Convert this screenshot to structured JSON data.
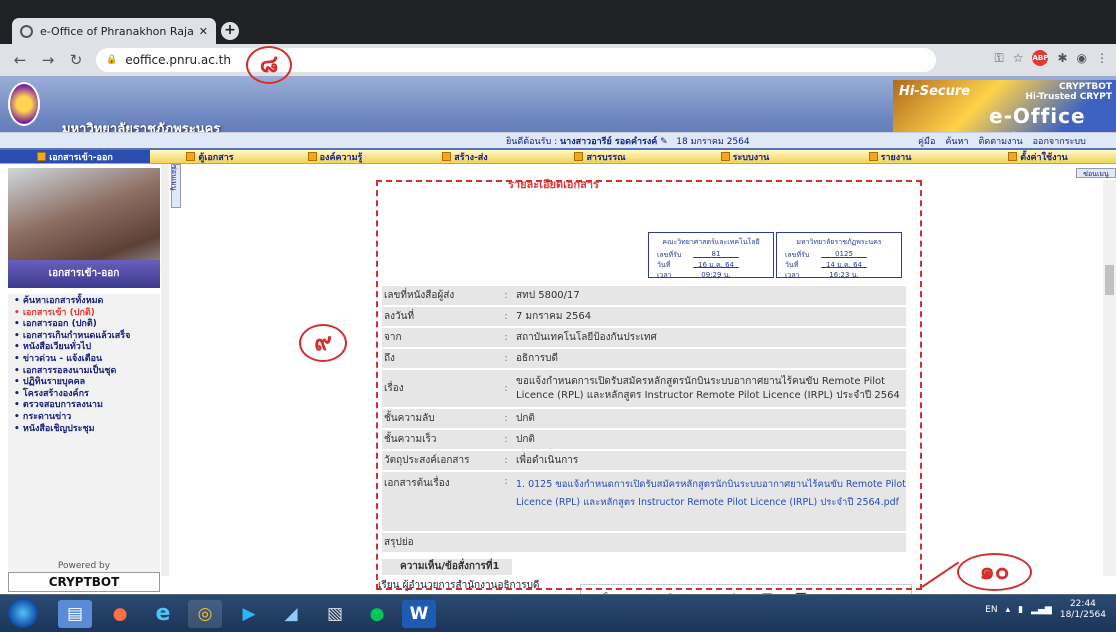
{
  "browser": {
    "tab_title": "e-Office of Phranakhon Rajabhat",
    "url": "eoffice.pnru.ac.th"
  },
  "header": {
    "university": "มหาวิทยาลัยราชภัฏพระนคร",
    "cryptbot": "CRYPTBOT",
    "hitrusted": "Hi-Trusted CRYPT",
    "hisecure": "Hi-Secure",
    "eoffice": "e-Office",
    "bot": "BOT",
    "welcome_prefix": "ยินดีต้อนรับ :",
    "welcome_user": "นางสาวอารีย์ รอดคำรงค์",
    "date": "18 มกราคม 2564",
    "tools": [
      "คู่มือ",
      "ค้นหา",
      "ติดตามงาน",
      "ออกจากระบบ"
    ]
  },
  "menu": [
    "เอกสารเข้า-ออก",
    "ตู้เอกสาร",
    "องค์ความรู้",
    "สร้าง-ส่ง",
    "สารบรรณ",
    "ระบบงาน",
    "รายงาน",
    "ตั้งค่าใช้งาน"
  ],
  "sidebar": {
    "section_label": "เอกสารเข้า-ออก",
    "items": [
      "ค้นหาเอกสารทั้งหมด",
      "เอกสารเข้า (ปกติ)",
      "เอกสารออก (ปกติ)",
      "เอกสารเกินกำหนดแล้วเสร็จ",
      "หนังสือเวียนทั่วไป",
      "ข่าวด่วน - แจ้งเตือน",
      "เอกสารรอลงนามเป็นชุด",
      "ปฏิทินรายบุคคล",
      "โครงสร้างองค์กร",
      "ตรวจสอบการลงนาม",
      "กระดานข่าว",
      "หนังสือเชิญประชุม"
    ],
    "powered": "Powered by",
    "cryptbot": "CRYPTBOT",
    "tab_label": "ซ่อนเมนู"
  },
  "content_tab": "ซ่อนเมนู",
  "document": {
    "title": "รายละเอียดเอกสาร",
    "stamp1": {
      "org": "คณะวิทยาศาสตร์และเทคโนโลยี",
      "no_label": "เลขที่รับ",
      "no": "81",
      "date_label": "วันที่",
      "date": "16 ม.ค. 64",
      "time_label": "เวลา",
      "time": "09:29 น."
    },
    "stamp2": {
      "org": "มหาวิทยาลัยราชภัฏพระนคร",
      "no_label": "เลขที่รับ",
      "no": "0125",
      "date_label": "วันที่",
      "date": "14 ม.ค. 64",
      "time_label": "เวลา",
      "time": "16:23 น."
    },
    "rows": [
      {
        "label": "เลขที่หนังสือผู้ส่ง",
        "value": "สทป 5800/17"
      },
      {
        "label": "ลงวันที่",
        "value": "7 มกราคม 2564"
      },
      {
        "label": "จาก",
        "value": "สถาบันเทคโนโลยีป้องกันประเทศ"
      },
      {
        "label": "ถึง",
        "value": "อธิการบดี"
      },
      {
        "label": "เรื่อง",
        "value": "ขอแจ้งกำหนดการเปิดรับสมัครหลักสูตรนักบินระบบอากาศยานไร้คนขับ Remote Pilot Licence (RPL) และหลักสูตร Instructor Remote Pilot Licence (IRPL) ประจำปี 2564"
      },
      {
        "label": "ชั้นความลับ",
        "value": "ปกติ"
      },
      {
        "label": "ชั้นความเร็ว",
        "value": "ปกติ"
      },
      {
        "label": "วัตถุประสงค์เอกสาร",
        "value": "เพื่อดำเนินการ"
      },
      {
        "label": "เอกสารต้นเรื่อง",
        "value": "1. 0125 ขอแจ้งกำหนดการเปิดรับสมัครหลักสูตรนักบินระบบอากาศยานไร้คนขับ Remote Pilot Licence (RPL) และหลักสูตร Instructor Remote Pilot Licence (IRPL) ประจำปี 2564.pdf"
      },
      {
        "label": "สรุปย่อ",
        "value": ""
      }
    ],
    "comment_header": "ความเห็น/ข้อสั่งการที่1",
    "comment_text": "เรียน ผู้อำนวยการสำนักงานอธิการบดี"
  },
  "annotations": {
    "c8": "๘",
    "c9": "๙",
    "c10": "๑๐"
  },
  "taskbar": {
    "lang": "EN",
    "time": "22:44",
    "date": "18/1/2564"
  }
}
